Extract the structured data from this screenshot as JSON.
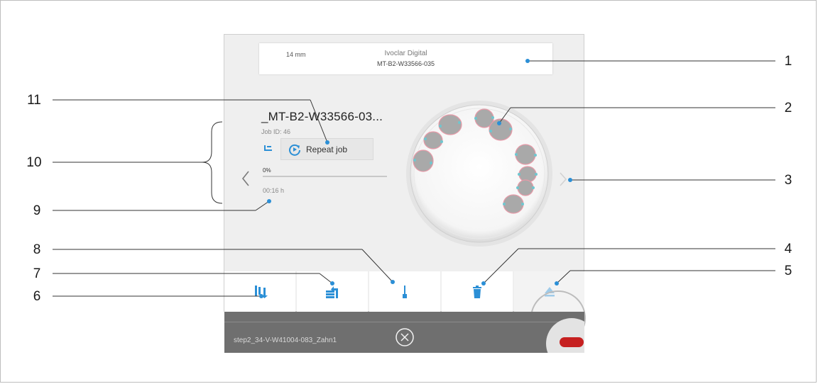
{
  "header": {
    "blank_size": "14 mm",
    "brand": "Ivoclar Digital",
    "blank_code": "MT-B2-W33566-035"
  },
  "job": {
    "title": "_MT-B2-W33566-03...",
    "job_id": "Job ID: 46",
    "repeat_label": "Repeat job",
    "progress_text": "0%",
    "progress_value": 0,
    "time": "00:16 h"
  },
  "toolbar": {
    "buttons": [
      {
        "icon": "tools-swap-icon",
        "enabled": true
      },
      {
        "icon": "job-queue-icon",
        "enabled": true
      },
      {
        "icon": "tool-icon",
        "enabled": true
      },
      {
        "icon": "trash-icon",
        "enabled": true
      },
      {
        "icon": "eject-icon",
        "enabled": false
      }
    ]
  },
  "footer": {
    "next_job": "step2_34-V-W41004-083_Zahn1"
  },
  "callouts": [
    "1",
    "2",
    "3",
    "4",
    "5",
    "6",
    "7",
    "8",
    "9",
    "10",
    "11"
  ],
  "colors": {
    "accent": "#2b8fd6",
    "screen_bg": "#efefef",
    "footer_bg": "#6f6f6f",
    "stop_red": "#c62020"
  }
}
